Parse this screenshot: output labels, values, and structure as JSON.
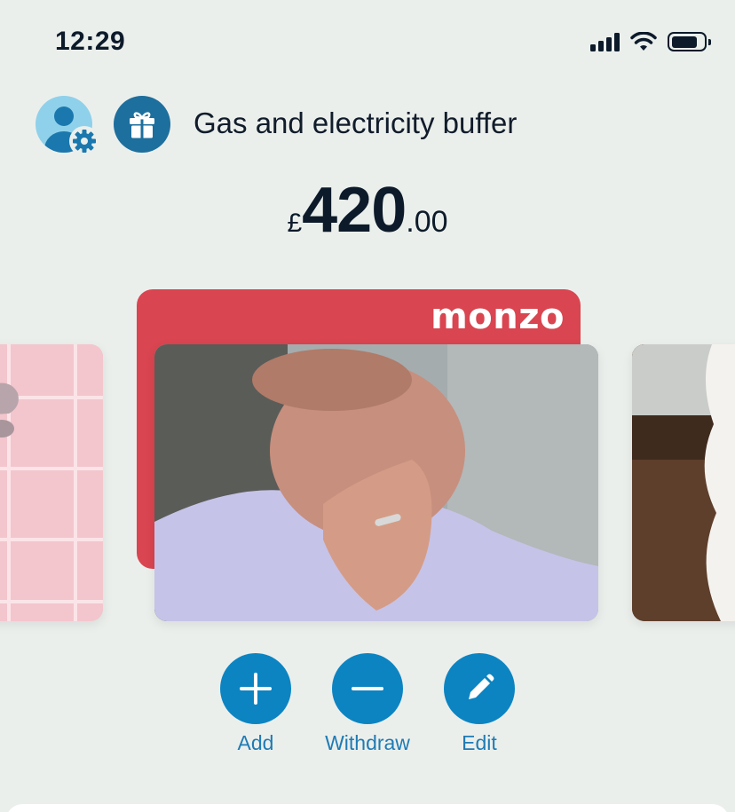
{
  "status_bar": {
    "time": "12:29"
  },
  "header": {
    "pot_name": "Gas and electricity buffer"
  },
  "balance": {
    "currency": "£",
    "whole": "420",
    "fraction": ".00"
  },
  "card": {
    "brand": "monzo",
    "brand_color": "#d94550"
  },
  "actions": {
    "add_label": "Add",
    "withdraw_label": "Withdraw",
    "edit_label": "Edit",
    "button_color": "#0c84c2"
  }
}
